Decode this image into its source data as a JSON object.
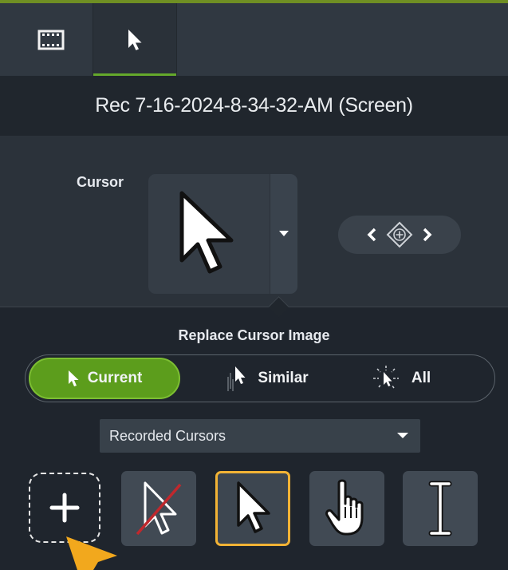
{
  "tabs": [
    {
      "icon": "film-strip-icon"
    },
    {
      "icon": "cursor-arrow-icon",
      "active": true
    }
  ],
  "media_title": "Rec 7-16-2024-8-34-32-AM (Screen)",
  "cursor_property": {
    "label": "Cursor",
    "current_icon": "arrow-cursor-icon",
    "nav_icons": [
      "chevron-left-icon",
      "add-keyframe-icon",
      "chevron-right-icon"
    ]
  },
  "replace": {
    "title": "Replace Cursor Image",
    "options": [
      {
        "label": "Current",
        "icon": "cursor-arrow-icon",
        "selected": true
      },
      {
        "label": "Similar",
        "icon": "similar-cursor-icon"
      },
      {
        "label": "All",
        "icon": "all-cursor-icon"
      }
    ],
    "dropdown_value": "Recorded Cursors"
  },
  "cursor_tiles": [
    {
      "icon": "add-icon"
    },
    {
      "icon": "no-cursor-icon"
    },
    {
      "icon": "arrow-cursor-icon",
      "selected": true
    },
    {
      "icon": "hand-cursor-icon"
    },
    {
      "icon": "ibeam-cursor-icon"
    }
  ],
  "colors": {
    "accent_green": "#5c9d1c",
    "selected_outline": "#f2b335",
    "hint_arrow": "#f2a81d"
  }
}
